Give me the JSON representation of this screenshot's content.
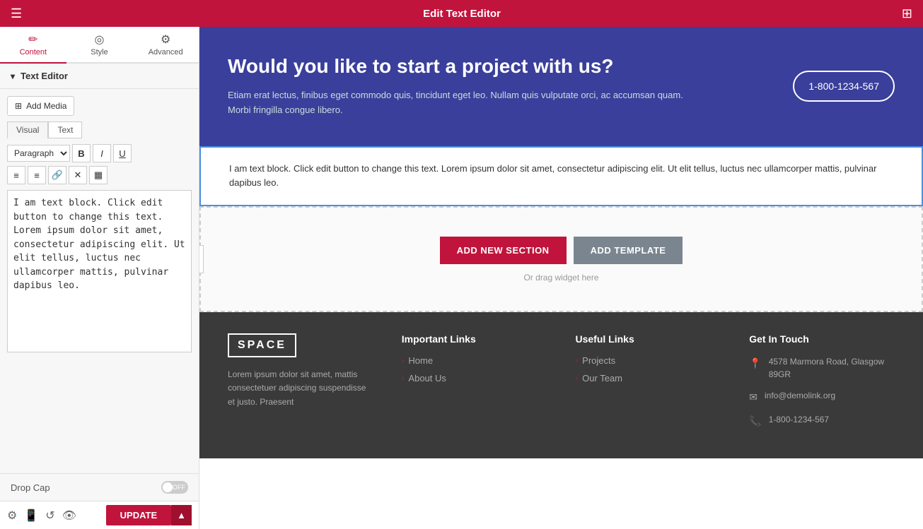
{
  "topbar": {
    "title": "Edit Text Editor",
    "menu_icon": "☰",
    "grid_icon": "⊞"
  },
  "sidebar": {
    "tabs": [
      {
        "id": "content",
        "label": "Content",
        "icon": "✏️",
        "active": true
      },
      {
        "id": "style",
        "label": "Style",
        "icon": "◎",
        "active": false
      },
      {
        "id": "advanced",
        "label": "Advanced",
        "icon": "⚙",
        "active": false
      }
    ],
    "section_title": "Text Editor",
    "add_media_label": "Add Media",
    "visual_tab": "Visual",
    "text_tab": "Text",
    "format_options": [
      "Paragraph"
    ],
    "toolbar_buttons": [
      "B",
      "I",
      "U"
    ],
    "toolbar2_buttons": [
      "≡",
      "≡",
      "🔗",
      "✕",
      "▦"
    ],
    "editor_text": "I am text block. Click edit button to change this text. Lorem ipsum dolor sit amet, consectetur adipiscing elit. Ut elit tellus, luctus nec ullamcorper mattis, pulvinar dapibus leo.",
    "drop_cap_label": "Drop Cap",
    "toggle_state": "OFF"
  },
  "bottom_bar": {
    "update_label": "UPDATE"
  },
  "hero": {
    "title": "Would you like to start a project with us?",
    "description": "Etiam erat lectus, finibus eget commodo quis, tincidunt eget leo. Nullam quis vulputate orci, ac accumsan quam. Morbi fringilla congue libero.",
    "phone": "1-800-1234-567"
  },
  "text_block": {
    "content": "I am text block. Click edit button to change this text. Lorem ipsum dolor sit amet, consectetur adipiscing elit. Ut elit tellus, luctus nec ullamcorper mattis, pulvinar dapibus leo."
  },
  "add_section": {
    "add_new_section_label": "ADD NEW SECTION",
    "add_template_label": "ADD TEMPLATE",
    "drag_hint": "Or drag widget here"
  },
  "footer": {
    "logo": "SPACE",
    "description": "Lorem ipsum dolor sit amet, mattis consectetuer adipiscing suspendisse et justo. Praesent",
    "important_links_title": "Important Links",
    "important_links": [
      {
        "label": "Home"
      },
      {
        "label": "About Us"
      }
    ],
    "useful_links_title": "Useful Links",
    "useful_links": [
      {
        "label": "Projects"
      },
      {
        "label": "Our Team"
      }
    ],
    "contact_title": "Get In Touch",
    "contact_items": [
      {
        "icon": "📍",
        "text": "4578 Marmora Road, Glasgow 89GR"
      },
      {
        "icon": "✉",
        "text": "info@demolink.org"
      },
      {
        "icon": "📞",
        "text": "1-800-1234-567"
      }
    ]
  }
}
